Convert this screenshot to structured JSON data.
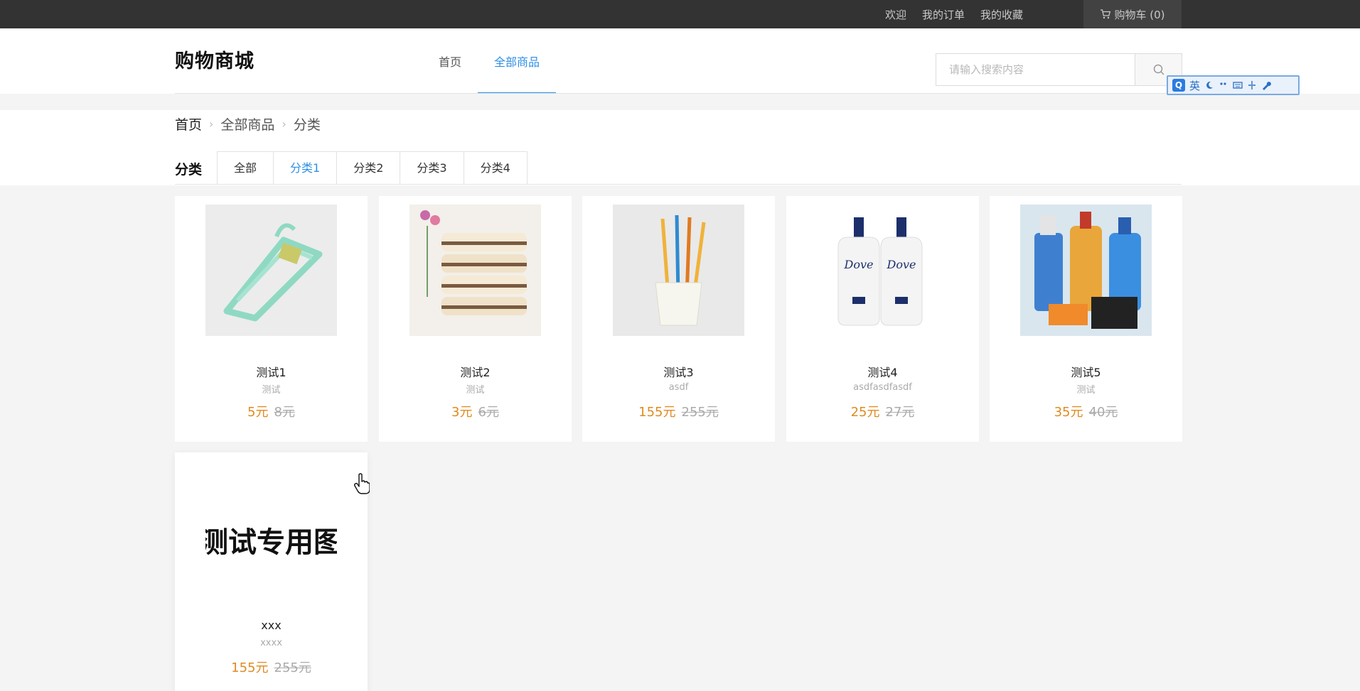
{
  "topbar": {
    "welcome": "欢迎",
    "orders": "我的订单",
    "favorites": "我的收藏",
    "cart_label": "购物车 (0)"
  },
  "header": {
    "logo": "购物商城",
    "nav": [
      {
        "label": "首页"
      },
      {
        "label": "全部商品"
      }
    ],
    "active_nav": 1,
    "search": {
      "placeholder": "请输入搜索内容",
      "value": ""
    },
    "ime": {
      "logo": "Q",
      "lang": "英"
    }
  },
  "breadcrumb": [
    "首页",
    "全部商品",
    "分类"
  ],
  "category": {
    "label": "分类",
    "tabs": [
      "全部",
      "分类1",
      "分类2",
      "分类3",
      "分类4"
    ],
    "active_tab": 1
  },
  "products": [
    {
      "name": "测试1",
      "desc": "测试",
      "price": "5元",
      "old_price": "8元",
      "image": "hanger"
    },
    {
      "name": "测试2",
      "desc": "测试",
      "price": "3元",
      "old_price": "6元",
      "image": "towels"
    },
    {
      "name": "测试3",
      "desc": "asdf",
      "price": "155元",
      "old_price": "255元",
      "image": "toothbrushes"
    },
    {
      "name": "测试4",
      "desc": "asdfasdfasdf",
      "price": "25元",
      "old_price": "27元",
      "image": "dove-bottles",
      "image_text": "Dove"
    },
    {
      "name": "测试5",
      "desc": "测试",
      "price": "35元",
      "old_price": "40元",
      "image": "detergents"
    },
    {
      "name": "xxx",
      "desc": "xxxx",
      "price": "155元",
      "old_price": "255元",
      "image": "test-text",
      "image_text": "测试专用图"
    }
  ],
  "colors": {
    "accent": "#2c8fe6",
    "price": "#e08a1f",
    "topbar": "#333333"
  }
}
